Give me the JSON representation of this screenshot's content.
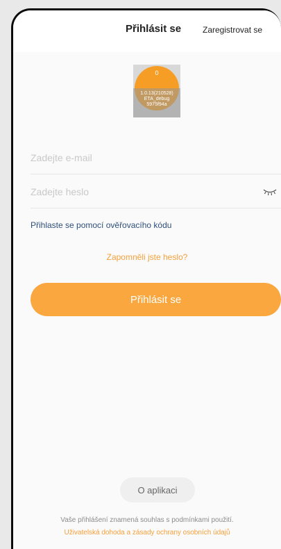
{
  "header": {
    "title": "Přihlásit se",
    "register_link": "Zaregistrovat se"
  },
  "logo": {
    "counter": "0",
    "debug_lines": [
      "1.0.13(210528)",
      "ETA_debug",
      "5975f94a"
    ]
  },
  "form": {
    "email_placeholder": "Zadejte e-mail",
    "password_placeholder": "Zadejte heslo",
    "code_login_link": "Přihlaste se pomocí ověřovacího kódu",
    "forgot_password_link": "Zapomněli jste heslo?",
    "login_button": "Přihlásit se"
  },
  "footer": {
    "about_button": "O aplikaci",
    "terms_text": "Vaše přihlášení znamená souhlas s podmínkami použití.",
    "terms_link": "Uživatelská dohoda a zásady ochrany osobních údajů"
  },
  "colors": {
    "accent": "#f9a73e",
    "link": "#2e4f7c",
    "background": "#fafafa"
  }
}
